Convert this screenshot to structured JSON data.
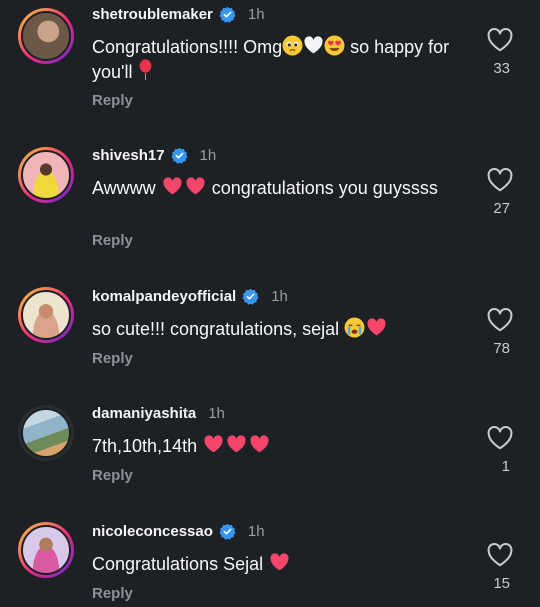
{
  "comments": [
    {
      "username": "shetroublemaker",
      "verified": true,
      "time": "1h",
      "text_parts": [
        "Congratulations!!!! Omg",
        "pleading-face-emoji",
        "white-heart-emoji",
        "heart-eyes-emoji",
        " so happy for you'll ",
        "balloon-emoji"
      ],
      "text_a": "Congratulations!!!! Omg",
      "text_b": " so happy for you'll ",
      "reply": "Reply",
      "likes": "33",
      "avatar_colors": [
        "#6b5847",
        "#c9a48a"
      ]
    },
    {
      "username": "shivesh17",
      "verified": true,
      "time": "1h",
      "text_a": "Awwww ",
      "text_b": " congratulations you guyssss",
      "reply": "Reply",
      "likes": "27",
      "avatar_colors": [
        "#f0b5b8",
        "#f1d63c"
      ]
    },
    {
      "username": "komalpandeyofficial",
      "verified": true,
      "time": "1h",
      "text_a": "so cute!!! congratulations, sejal ",
      "reply": "Reply",
      "likes": "78",
      "avatar_colors": [
        "#e8d6b8",
        "#c98b6e"
      ]
    },
    {
      "username": "damaniyashita",
      "verified": false,
      "time": "1h",
      "text_a": "7th,10th,14th ",
      "reply": "Reply",
      "likes": "1",
      "avatar_colors": [
        "#8fb3c9",
        "#6d8a5a"
      ]
    },
    {
      "username": "nicoleconcessao",
      "verified": true,
      "time": "1h",
      "text_a": "Congratulations Sejal ",
      "reply": "Reply",
      "likes": "15",
      "avatar_colors": [
        "#b49bd6",
        "#d95aa0"
      ]
    }
  ],
  "colors": {
    "background": "#1d2024",
    "verified": "#3797f0",
    "heart_emoji": "#f4466b"
  }
}
